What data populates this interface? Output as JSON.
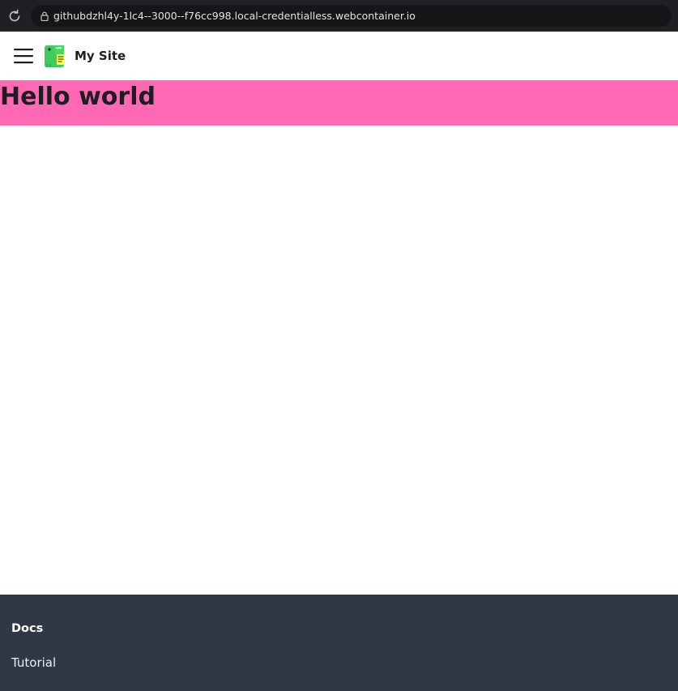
{
  "browser": {
    "url": "githubdzhl4y-1lc4--3000--f76cc998.local-credentialless.webcontainer.io",
    "reload_icon": "reload-icon",
    "lock_icon": "lock-icon"
  },
  "navbar": {
    "menu_icon": "hamburger-menu-icon",
    "logo_icon": "dinosaur-logo-icon",
    "title": "My Site"
  },
  "hero": {
    "title": "Hello world",
    "background": "#ff69b4"
  },
  "footer": {
    "background": "#303846",
    "column_title": "Docs",
    "links": [
      {
        "label": "Tutorial"
      }
    ]
  }
}
